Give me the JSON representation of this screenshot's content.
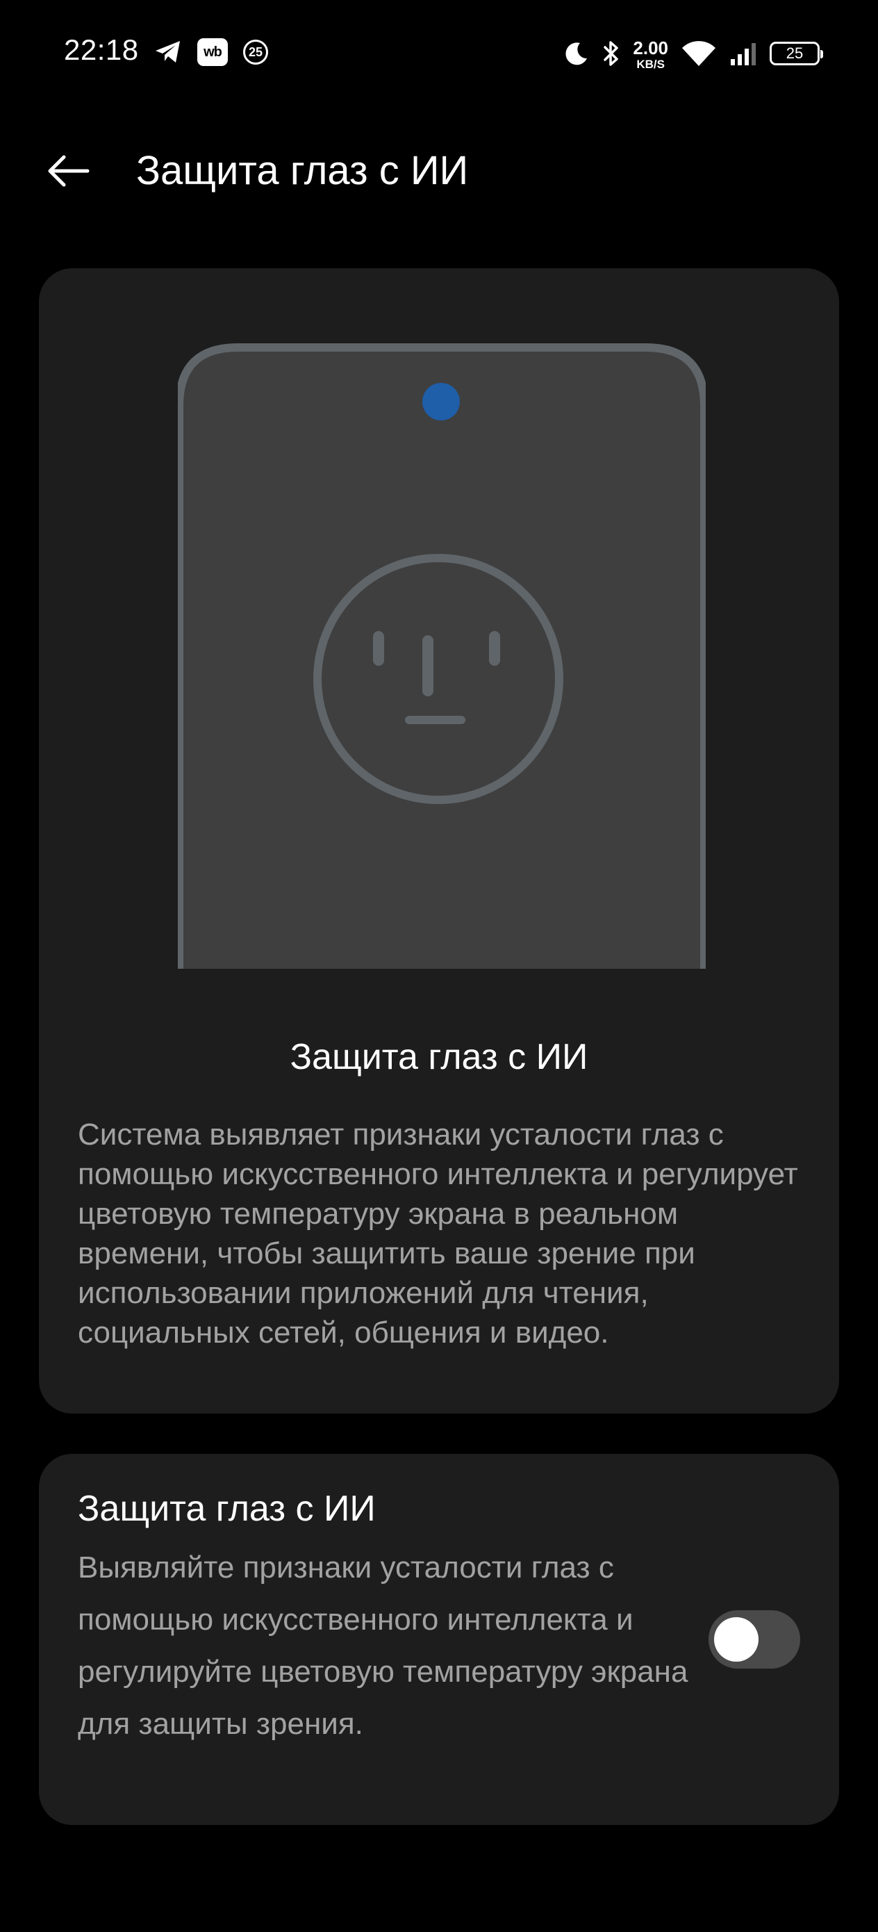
{
  "status_bar": {
    "time": "22:18",
    "wb_label": "wb",
    "notification_count": "25",
    "net_speed_value": "2.00",
    "net_speed_unit": "KB/S",
    "battery_level": "25",
    "icons": [
      "telegram-icon",
      "wb-app-icon",
      "badge-25-icon",
      "moon-icon",
      "bluetooth-icon",
      "wifi-icon",
      "signal-icon",
      "battery-icon"
    ]
  },
  "header": {
    "back_icon": "arrow-left-icon",
    "title": "Защита глаз с ИИ"
  },
  "info_card": {
    "illustration": "phone-face-illustration",
    "title": "Защита глаз с ИИ",
    "description": "Система выявляет признаки усталости глаз с помощью искусственного интеллекта и регулирует цветовую температуру экрана в реальном времени, чтобы защитить ваше зрение при использовании приложений для чтения, социальных сетей, общения и видео."
  },
  "setting": {
    "title": "Защита глаз с ИИ",
    "description": "Выявляйте признаки усталости глаз с помощью искусственного интеллекта и регулируйте цветовую температуру экрана для защиты зрения.",
    "enabled": false
  },
  "colors": {
    "background": "#000000",
    "card": "#1d1d1d",
    "secondary_text": "#a2a2a2",
    "toggle_off_track": "#4a4a4a",
    "camera_dot": "#1f5ea8",
    "illustration_stroke": "#5f6569",
    "illustration_screen": "#3f3f3f"
  }
}
